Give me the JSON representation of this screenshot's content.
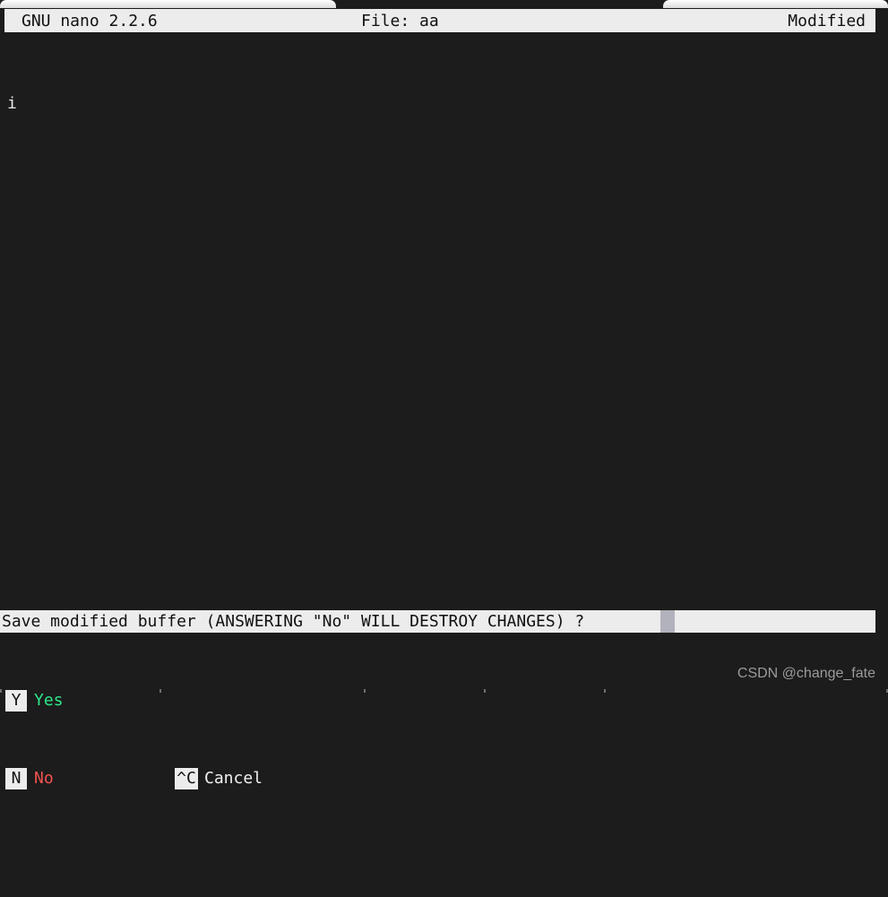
{
  "window": {
    "tabs": [
      {
        "name": "terminal-tab-left",
        "label": ""
      },
      {
        "name": "terminal-tab-right",
        "label": ""
      }
    ]
  },
  "titlebar": {
    "version": "GNU nano 2.2.6",
    "filename": "File: aa",
    "status": "Modified"
  },
  "editor": {
    "lines": [
      "i"
    ],
    "cursor": {
      "line": 1,
      "col": 1
    }
  },
  "prompt": {
    "question": "Save modified buffer (ANSWERING \"No\" WILL DESTROY CHANGES) ? ",
    "input_value": "",
    "cursor_visible": true,
    "cursor_color": "#b2b2bd"
  },
  "answers": [
    {
      "key": "Y",
      "label": "Yes",
      "color": "#2ee88a"
    },
    {
      "key": "N",
      "label": "No",
      "color": "#f2524f"
    },
    {
      "key": "^C",
      "label": "Cancel",
      "color": "#f1f1f1"
    }
  ],
  "watermark": {
    "text": "CSDN @change_fate"
  },
  "colors": {
    "terminal_bg": "#1c1c1c",
    "terminal_fg": "#e8e8e8",
    "inverse_bg": "#ececec",
    "inverse_fg": "#101010"
  }
}
